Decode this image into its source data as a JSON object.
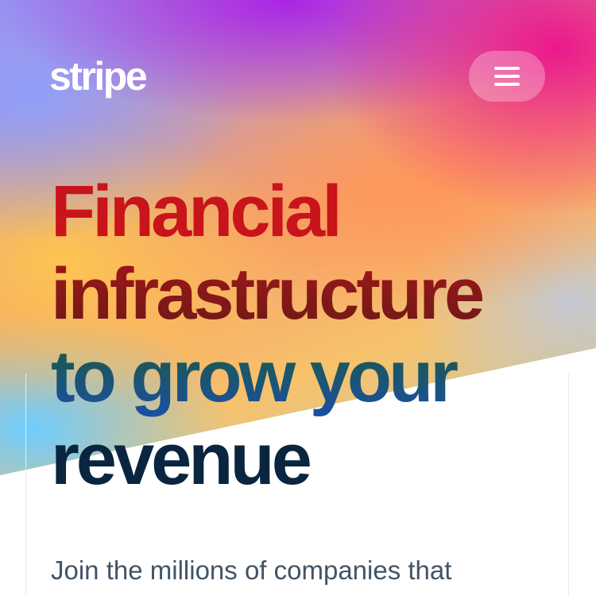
{
  "header": {
    "logo_text": "stripe",
    "menu_button_icon": "hamburger-menu-icon"
  },
  "hero": {
    "headline_lines": [
      "Financial",
      "infrastructure",
      "to grow your",
      "revenue"
    ],
    "subtitle": "Join the millions of companies that"
  },
  "colors": {
    "headline_red": "#c8141a",
    "headline_dark": "#0a2540",
    "subtitle_text": "#425466",
    "accent_magenta": "#ec108c",
    "accent_purple": "#aa1ee6",
    "accent_orange": "#ff9a5a",
    "accent_yellow": "#ffc450",
    "accent_cyan": "#6ecdff"
  }
}
